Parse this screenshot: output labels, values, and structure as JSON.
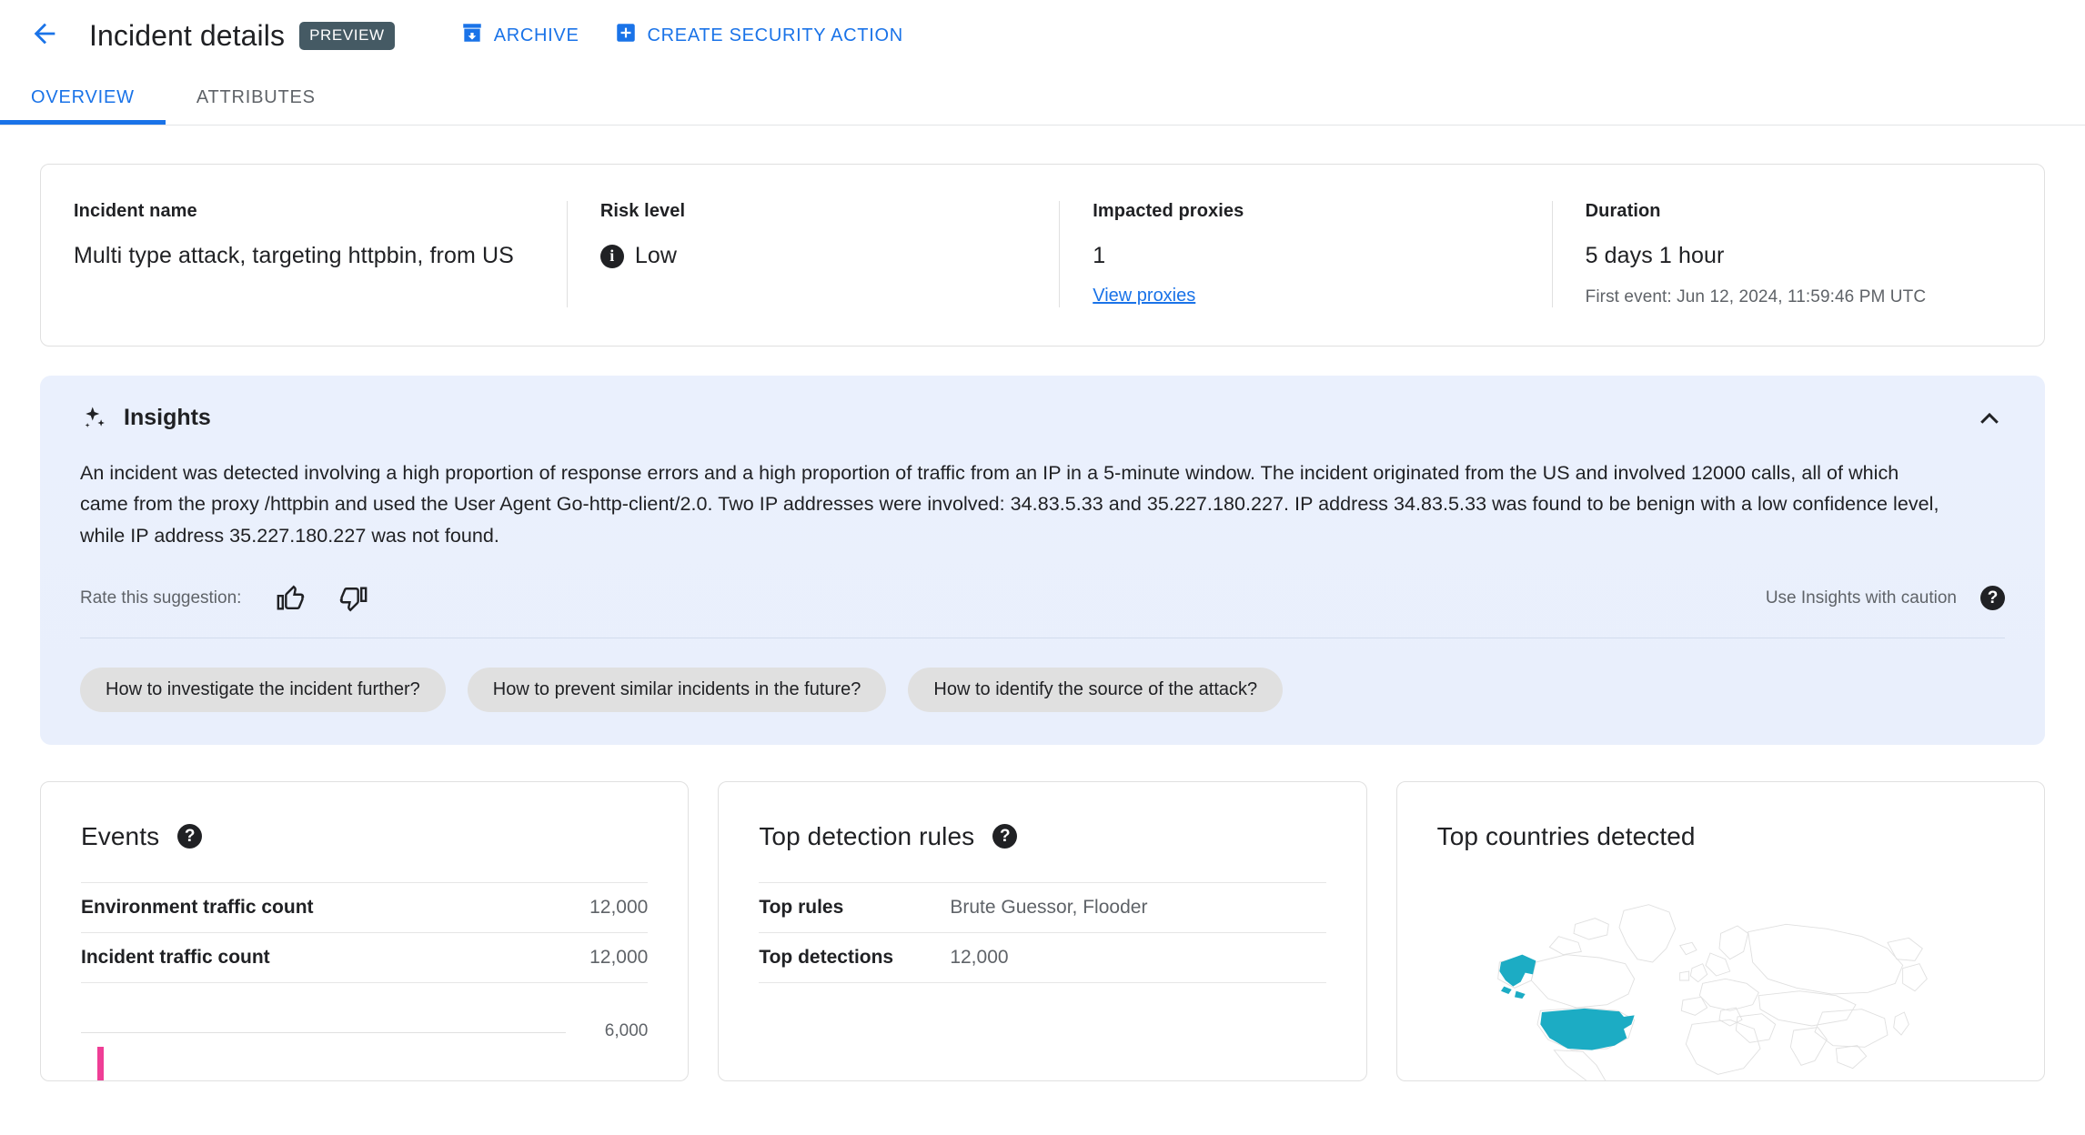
{
  "header": {
    "back_icon": "arrow-back-icon",
    "title": "Incident details",
    "preview_badge": "PREVIEW",
    "actions": [
      {
        "label": "ARCHIVE",
        "icon": "archive-icon"
      },
      {
        "label": "CREATE SECURITY ACTION",
        "icon": "plus-box-icon"
      }
    ]
  },
  "tabs": [
    {
      "label": "OVERVIEW",
      "active": true
    },
    {
      "label": "ATTRIBUTES",
      "active": false
    }
  ],
  "summary": {
    "incident_name_label": "Incident name",
    "incident_name_value": "Multi type attack, targeting httpbin, from US",
    "risk_level_label": "Risk level",
    "risk_level_value": "Low",
    "risk_icon": "info-icon",
    "impacted_proxies_label": "Impacted proxies",
    "impacted_proxies_value": "1",
    "view_proxies_link": "View proxies",
    "duration_label": "Duration",
    "duration_value": "5 days 1 hour",
    "first_event": "First event: Jun 12, 2024, 11:59:46 PM UTC"
  },
  "insights": {
    "title": "Insights",
    "sparkle_icon": "sparkle-icon",
    "collapse_icon": "chevron-up-icon",
    "body": "An incident was detected involving a high proportion of response errors and a high proportion of traffic from an IP in a 5-minute window. The incident originated from the US and involved 12000 calls, all of which came from the proxy /httpbin and used the User Agent Go-http-client/2.0. Two IP addresses were involved: 34.83.5.33 and 35.227.180.227. IP address 34.83.5.33 was found to be benign with a low confidence level, while IP address 35.227.180.227 was not found.",
    "rate_label": "Rate this suggestion:",
    "thumb_up_icon": "thumb-up-icon",
    "thumb_down_icon": "thumb-down-icon",
    "caution_text": "Use Insights with caution",
    "help_icon": "help-icon",
    "chips": [
      "How to investigate the incident further?",
      "How to prevent similar incidents in the future?",
      "How to identify the source of the attack?"
    ]
  },
  "events_card": {
    "title": "Events",
    "help_icon": "help-icon",
    "rows": [
      {
        "key": "Environment traffic count",
        "value": "12,000"
      },
      {
        "key": "Incident traffic count",
        "value": "12,000"
      }
    ],
    "chart_gridline_label": "6,000",
    "bar_color": "#ef3e96"
  },
  "detection_card": {
    "title": "Top detection rules",
    "help_icon": "help-icon",
    "rows": [
      {
        "key": "Top rules",
        "value": "Brute Guessor, Flooder"
      },
      {
        "key": "Top detections",
        "value": "12,000"
      }
    ]
  },
  "countries_card": {
    "title": "Top countries detected",
    "highlight_color": "#1cacc4",
    "map_base_color": "#e0e0e0",
    "highlighted_regions": [
      "United States",
      "Alaska"
    ]
  },
  "chart_data": {
    "type": "bar",
    "title": "Events",
    "categories": [
      "Incident traffic"
    ],
    "values": [
      12000
    ],
    "ylabel": "",
    "xlabel": "",
    "ylim": [
      0,
      12000
    ],
    "gridlines": [
      6000
    ],
    "gridline_labels": [
      "6,000"
    ],
    "series": [
      {
        "name": "Environment traffic count",
        "values": [
          12000
        ]
      },
      {
        "name": "Incident traffic count",
        "values": [
          12000
        ]
      }
    ],
    "legend": "none",
    "grid": true
  },
  "colors": {
    "accent": "#1a73e8",
    "badge": "#455a64",
    "insight_bg": "#eaf0fd",
    "bar": "#ef3e96",
    "map_highlight": "#1cacc4"
  }
}
